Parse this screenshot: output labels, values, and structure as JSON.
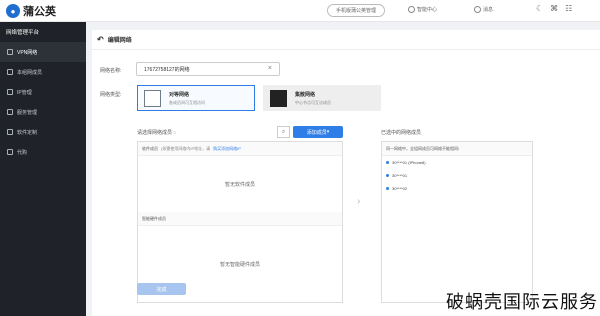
{
  "brand": {
    "name": "蒲公英"
  },
  "topbar": {
    "pill_text": "手机版蒲公英管理",
    "link1": "智能中心",
    "link2": "消息"
  },
  "sidebar": {
    "title": "网络管理平台",
    "items": [
      {
        "label": "VPN网络"
      },
      {
        "label": "本组网成员"
      },
      {
        "label": "IP管理"
      },
      {
        "label": "服务管理"
      },
      {
        "label": "软件定制"
      },
      {
        "label": "代购"
      }
    ]
  },
  "page": {
    "title": "编辑网络",
    "name_label": "网络名称:",
    "name_value": "17672758127的网络",
    "type_label": "网络类型:",
    "types": [
      {
        "title": "对等网络",
        "desc": "各成员间可互相访问"
      },
      {
        "title": "集散网络",
        "desc": "中心节点可互访成员"
      }
    ],
    "available_title": "请选择网络成员",
    "add_button": "添加成员",
    "software_title": "软件成员",
    "software_hint": "(如需使用网络内IP地址，请",
    "software_link": "购买添加网络IP",
    "software_empty": "暂无软件成员",
    "hardware_title": "智能硬件成员",
    "hardware_empty": "暂无智能硬件成员",
    "selected_title": "已选中的网络成员",
    "selected_head": "同一网络中，全组网成员可网络不能相同!",
    "members": [
      {
        "label": "30****01 (iPhone8)"
      },
      {
        "label": "30****01"
      },
      {
        "label": "30****02"
      }
    ],
    "submit": "完成"
  },
  "watermark": "破蜗壳国际云服务"
}
